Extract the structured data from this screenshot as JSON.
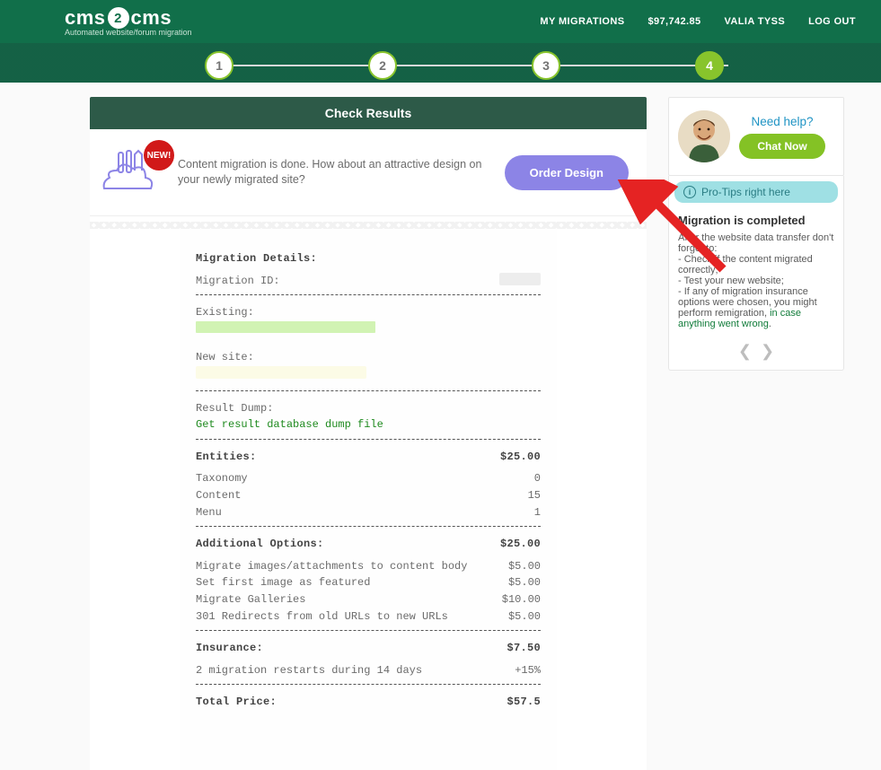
{
  "nav": {
    "my_migrations": "MY MIGRATIONS",
    "balance": "$97,742.85",
    "user": "VALIA TYSS",
    "logout": "LOG OUT",
    "logo_tag": "Automated website/forum migration"
  },
  "steps": [
    "1",
    "2",
    "3",
    "4"
  ],
  "panel_title": "Check Results",
  "order": {
    "badge": "NEW!",
    "text": "Content migration is done. How about an attractive design on your newly migrated site?",
    "button": "Order Design"
  },
  "receipt": {
    "section_details": "Migration Details:",
    "migration_id_label": "Migration ID:",
    "existing_label": "Existing:",
    "new_site_label": "New site:",
    "result_dump_label": "Result Dump:",
    "result_dump_link": "Get result database dump file",
    "entities_header": "Entities:",
    "entities_total": "$25.00",
    "entities": [
      {
        "name": "Taxonomy",
        "count": "0"
      },
      {
        "name": "Content",
        "count": "15"
      },
      {
        "name": "Menu",
        "count": "1"
      }
    ],
    "addl_header": "Additional Options:",
    "addl_total": "$25.00",
    "addl": [
      {
        "name": "Migrate images/attachments to content body",
        "price": "$5.00"
      },
      {
        "name": "Set first image as featured",
        "price": "$5.00"
      },
      {
        "name": "Migrate Galleries",
        "price": "$10.00"
      },
      {
        "name": "301 Redirects from old URLs to new URLs",
        "price": "$5.00"
      }
    ],
    "insurance_header": "Insurance:",
    "insurance_total": "$7.50",
    "insurance_line": {
      "name": "2 migration restarts during 14 days",
      "price": "+15%"
    },
    "total_label": "Total Price:",
    "total_value": "$57.5"
  },
  "help": {
    "need_help": "Need help?",
    "chat_now": "Chat Now"
  },
  "tips": {
    "header": "Pro-Tips right here",
    "title": "Migration is completed",
    "intro": "After the website data transfer don't forget to:",
    "bullets": [
      "- Check if the content migrated correctly;",
      "- Test your new website;",
      "- If any of migration insurance options were chosen, you might perform remigration, "
    ],
    "link": "in case anything went wrong"
  }
}
